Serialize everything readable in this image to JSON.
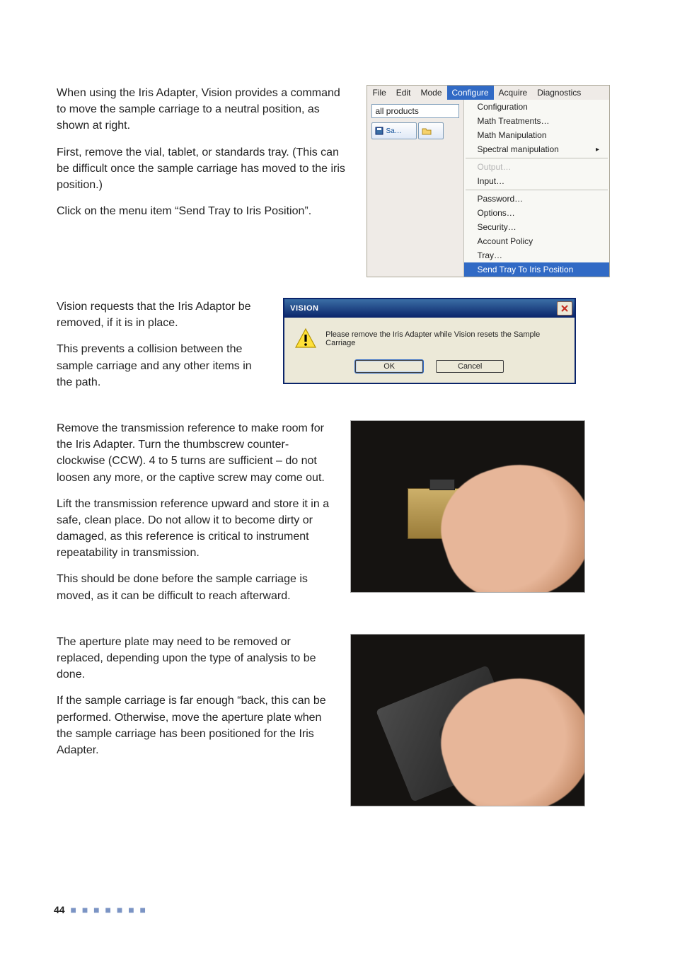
{
  "page_number": "44",
  "footer_dots": "■ ■ ■ ■ ■ ■ ■",
  "section1": {
    "p1": "When using the Iris Adapter, Vision provides a command to move the sample carriage to a neutral position, as shown at right.",
    "p2": "First, remove the vial, tablet, or standards tray. (This can be difficult once the sample carriage has moved to the iris position.)",
    "p3": "Click on the menu item “Send Tray to Iris Position”."
  },
  "menu": {
    "bar": {
      "file": "File",
      "edit": "Edit",
      "mode": "Mode",
      "configure": "Configure",
      "acquire": "Acquire",
      "diagnostics": "Diagnostics"
    },
    "combo_value": "all products",
    "tool_label": "Sa…",
    "items": {
      "configuration": "Configuration",
      "math_treatments": "Math Treatments…",
      "math_manipulation": "Math Manipulation",
      "spectral_manipulation": "Spectral manipulation",
      "output": "Output…",
      "input": "Input…",
      "password": "Password…",
      "options": "Options…",
      "security": "Security…",
      "account_policy": "Account Policy",
      "tray": "Tray…",
      "send_tray": "Send Tray To Iris Position"
    }
  },
  "section2": {
    "p1": "Vision requests that the Iris Adaptor be removed, if it is in place.",
    "p2": "This prevents a collision between the sample carriage and any other items in the path."
  },
  "dialog": {
    "title": "VISION",
    "message": "Please remove the Iris Adapter while Vision resets the Sample Carriage",
    "ok": "OK",
    "cancel": "Cancel"
  },
  "section3": {
    "p1": "Remove the transmission reference to make room for the Iris Adapter. Turn the thumbscrew counter-clockwise (CCW). 4 to 5 turns are sufficient – do not loosen any more, or the captive screw may come out.",
    "p2": "Lift the transmission reference upward and store it in a safe, clean place. Do not allow it to become dirty or damaged, as this reference is critical to instrument repeatability in transmission.",
    "p3": "This should be done before the sample carriage is moved, as it can be difficult to reach afterward."
  },
  "section4": {
    "p1": "The aperture plate may need to be removed or replaced, depending upon the type of analysis to be done.",
    "p2": "If the sample carriage is far enough “back, this can be performed. Otherwise, move the aperture plate when the sample carriage has been positioned for the Iris Adapter."
  }
}
